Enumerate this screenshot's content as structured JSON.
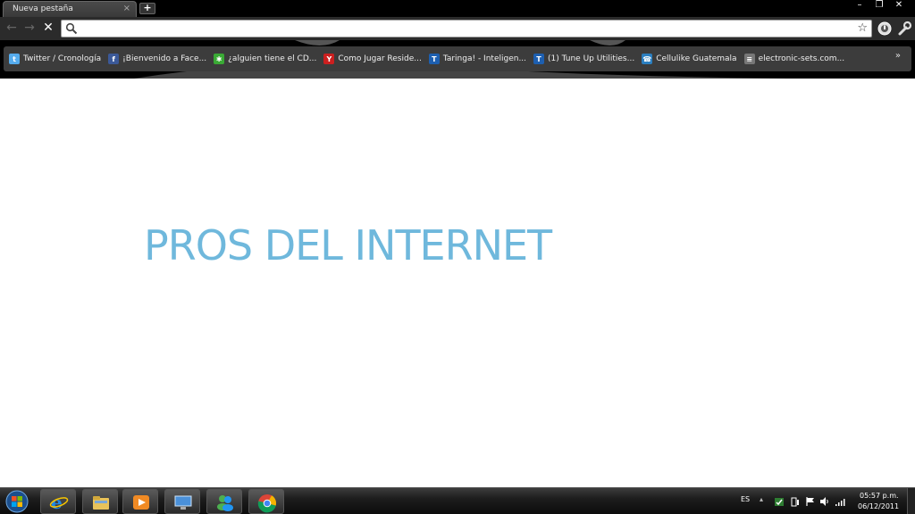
{
  "browser": {
    "tab": {
      "title": "Nueva pestaña",
      "close_glyph": "×"
    },
    "new_tab_glyph": "+",
    "window_controls": [
      "–",
      "❐",
      "✕"
    ],
    "toolbar": {
      "back_glyph": "←",
      "forward_glyph": "→",
      "stop_glyph": "✕",
      "address_value": "",
      "bookmark_star_glyph": "☆"
    },
    "bookmarks": [
      {
        "label": "Twitter / Cronología",
        "icon": "twitter-icon",
        "color": "#55acee",
        "glyph": "t"
      },
      {
        "label": "¡Bienvenido a Face...",
        "icon": "facebook-icon",
        "color": "#3b5998",
        "glyph": "f"
      },
      {
        "label": "¿alguien tiene el CD...",
        "icon": "star-icon",
        "color": "#3aaa35",
        "glyph": "✱"
      },
      {
        "label": "Como Jugar Reside...",
        "icon": "youtube-icon",
        "color": "#cc1f1f",
        "glyph": "Y"
      },
      {
        "label": "Taringa! - Inteligen...",
        "icon": "taringa-icon",
        "color": "#1d5fb0",
        "glyph": "T"
      },
      {
        "label": "(1) Tune Up Utilities...",
        "icon": "taringa-icon",
        "color": "#1d5fb0",
        "glyph": "T"
      },
      {
        "label": "Cellulike Guatemala",
        "icon": "phone-icon",
        "color": "#2b7fc0",
        "glyph": "☎"
      },
      {
        "label": "electronic-sets.com...",
        "icon": "page-icon",
        "color": "#777777",
        "glyph": "≡"
      }
    ],
    "bookmarks_more_glyph": "»"
  },
  "page": {
    "title": "PROS DEL INTERNET",
    "title_color": "#6fb8dc"
  },
  "taskbar": {
    "apps": [
      {
        "name": "internet-explorer-icon"
      },
      {
        "name": "file-explorer-icon"
      },
      {
        "name": "media-player-icon"
      },
      {
        "name": "remote-desktop-icon"
      },
      {
        "name": "messenger-icon"
      },
      {
        "name": "chrome-icon"
      }
    ],
    "language": "ES",
    "tray_expand_glyph": "▴",
    "time": "05:57 p.m.",
    "date": "06/12/2011"
  }
}
